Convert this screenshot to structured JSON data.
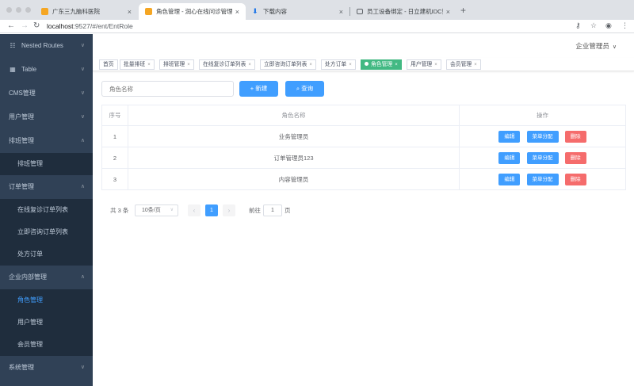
{
  "browser": {
    "tabs": [
      {
        "title": "广东三九脑科医院",
        "favicon_color": "#f5a623"
      },
      {
        "title": "角色管理 - 润心在线问诊管理端",
        "favicon_color": "#f5a623"
      },
      {
        "title": "下载内容",
        "favicon_color": "#1a73e8"
      },
      {
        "title": "员工设备绑定 - 日立建机IDC数据...",
        "favicon_color": "#5f6368"
      }
    ],
    "url_host": "localhost",
    "url_rest": ":9527/#/ent/EntRole"
  },
  "sidebar": {
    "items": [
      {
        "label": "Nested Routes",
        "icon": "nested-icon"
      },
      {
        "label": "Table",
        "icon": "table-icon"
      },
      {
        "label": "CMS管理"
      },
      {
        "label": "用户管理"
      },
      {
        "label": "排班管理"
      },
      {
        "label": "排班管理"
      },
      {
        "label": "订单管理"
      },
      {
        "label": "在线复诊订单列表"
      },
      {
        "label": "立即咨询订单列表"
      },
      {
        "label": "处方订单"
      },
      {
        "label": "企业内部管理"
      },
      {
        "label": "角色管理"
      },
      {
        "label": "用户管理"
      },
      {
        "label": "会员管理"
      },
      {
        "label": "系统管理"
      }
    ]
  },
  "header": {
    "user": "企业管理员"
  },
  "tags": [
    {
      "label": "首页"
    },
    {
      "label": "批量排班"
    },
    {
      "label": "排班管理"
    },
    {
      "label": "在线复诊订单列表"
    },
    {
      "label": "立即咨询订单列表"
    },
    {
      "label": "处方订单"
    },
    {
      "label": "角色管理"
    },
    {
      "label": "用户管理"
    },
    {
      "label": "会员管理"
    }
  ],
  "filter": {
    "placeholder": "角色名称",
    "create_label": "新建",
    "search_label": "查询"
  },
  "table": {
    "headers": [
      "序号",
      "角色名称",
      "操作"
    ],
    "rows": [
      {
        "index": "1",
        "name": "业务管理员"
      },
      {
        "index": "2",
        "name": "订单管理员123"
      },
      {
        "index": "3",
        "name": "内容管理员"
      }
    ],
    "actions": {
      "edit": "编辑",
      "assign": "菜单分配",
      "delete": "删除"
    }
  },
  "pagination": {
    "total_text": "共 3 条",
    "page_size": "10条/页",
    "current_page": "1",
    "goto_label": "前往",
    "goto_value": "1",
    "page_suffix": "页"
  },
  "colors": {
    "sidebar_bg": "#304156",
    "sidebar_sub_bg": "#1f2d3d",
    "primary": "#409eff",
    "danger": "#f56c6c",
    "active_tag": "#42b983"
  }
}
